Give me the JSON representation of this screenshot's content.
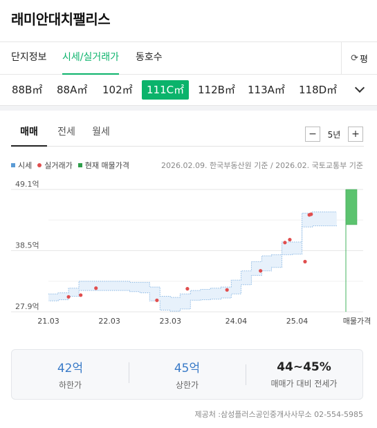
{
  "title": "래미안대치팰리스",
  "tabs": [
    {
      "label": "단지정보",
      "active": false
    },
    {
      "label": "시세/실거래가",
      "active": true
    },
    {
      "label": "동호수",
      "active": false
    }
  ],
  "tab_more_label": "평",
  "tab_more_icon": "refresh-icon",
  "types": [
    {
      "label": "88B㎡",
      "active": false
    },
    {
      "label": "88A㎡",
      "active": false
    },
    {
      "label": "102㎡",
      "active": false
    },
    {
      "label": "111C㎡",
      "active": true
    },
    {
      "label": "112B㎡",
      "active": false
    },
    {
      "label": "113A㎡",
      "active": false
    },
    {
      "label": "118D㎡",
      "active": false
    }
  ],
  "deal_tabs": [
    {
      "label": "매매",
      "active": true
    },
    {
      "label": "전세",
      "active": false
    },
    {
      "label": "월세",
      "active": false
    }
  ],
  "period": {
    "minus": "−",
    "value": "5년",
    "plus": "+"
  },
  "legend": [
    {
      "label": "시세",
      "color": "#5b9bd5",
      "shape": "square"
    },
    {
      "label": "실거래가",
      "color": "#e04e4e",
      "shape": "dot"
    },
    {
      "label": "현재 매물가격",
      "color": "#2e9e4a",
      "shape": "square"
    }
  ],
  "source": "2026.02.09. 한국부동산원 기준 / 2026.02. 국토교통부 기준",
  "chart_data": {
    "type": "line",
    "y_ticks": [
      "49.1억",
      "38.5억",
      "27.9억"
    ],
    "y_tick_values": [
      49.1,
      38.5,
      27.9
    ],
    "ylim": [
      27.9,
      49.1
    ],
    "x_ticks": [
      "21.03",
      "22.03",
      "23.03",
      "24.04",
      "25.04",
      "매물가격"
    ],
    "x_tick_values": [
      2021.17,
      2022.17,
      2023.17,
      2024.25,
      2025.25
    ],
    "xlim": [
      2021.17,
      2026.05
    ],
    "grid": true,
    "series": [
      {
        "label": "시세",
        "kind": "band",
        "color": "#5b9bd5",
        "x": [
          2021.17,
          2021.33,
          2021.5,
          2021.67,
          2021.83,
          2022.0,
          2022.17,
          2022.33,
          2022.5,
          2022.67,
          2022.83,
          2023.0,
          2023.17,
          2023.33,
          2023.5,
          2023.67,
          2023.83,
          2024.0,
          2024.17,
          2024.33,
          2024.5,
          2024.67,
          2024.83,
          2025.0,
          2025.17,
          2025.33,
          2025.5,
          2025.67,
          2025.9
        ],
        "low": [
          29.8,
          30.0,
          30.6,
          31.6,
          31.6,
          31.6,
          31.6,
          31.6,
          31.4,
          31.2,
          29.8,
          28.2,
          28.0,
          28.4,
          29.9,
          30.0,
          30.1,
          30.3,
          31.0,
          32.6,
          34.2,
          35.0,
          35.6,
          37.8,
          37.9,
          42.6,
          42.8,
          42.8,
          42.8
        ],
        "high": [
          31.0,
          31.2,
          32.0,
          33.2,
          33.2,
          33.2,
          33.2,
          33.2,
          33.0,
          33.0,
          32.2,
          30.6,
          30.4,
          31.0,
          31.6,
          31.8,
          32.0,
          32.2,
          33.4,
          35.0,
          36.6,
          37.6,
          37.8,
          40.0,
          40.0,
          45.0,
          45.2,
          45.2,
          45.2
        ]
      },
      {
        "label": "실거래가",
        "kind": "scatter",
        "color": "#e04e4e",
        "x": [
          2021.5,
          2021.7,
          2021.95,
          2022.95,
          2023.45,
          2024.1,
          2024.65,
          2025.05,
          2025.13,
          2025.38,
          2025.45,
          2025.48
        ],
        "y": [
          30.5,
          30.8,
          32.0,
          29.9,
          31.9,
          31.7,
          35.0,
          39.9,
          40.4,
          36.6,
          44.7,
          44.8
        ]
      },
      {
        "label": "현재 매물가격",
        "kind": "range",
        "color": "#2e9e4a",
        "x": 2026.05,
        "low": 43.0,
        "high": 49.1
      }
    ]
  },
  "summary": [
    {
      "value": "42억",
      "label": "하한가",
      "dark": false
    },
    {
      "value": "45억",
      "label": "상한가",
      "dark": false
    },
    {
      "value": "44~45%",
      "label": "매매가 대비 전세가",
      "dark": true
    }
  ],
  "provider": "제공처 :삼성플러스공인중개사사무소 02-554-5985"
}
